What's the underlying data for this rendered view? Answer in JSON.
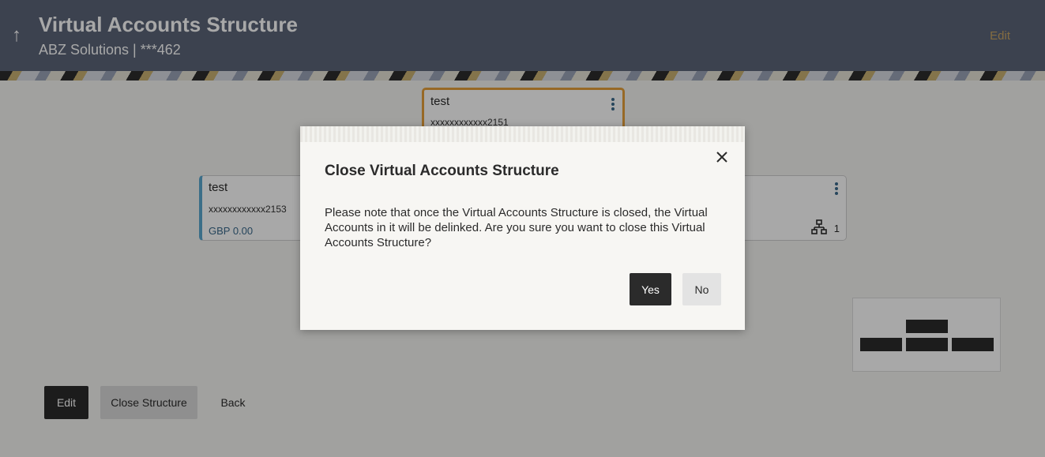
{
  "header": {
    "title": "Virtual Accounts Structure",
    "subtitle": "ABZ Solutions | ***462",
    "edit_label": "Edit",
    "back_icon": "arrow-up-icon"
  },
  "tree": {
    "top_node": {
      "name": "test",
      "account": "xxxxxxxxxxxx2151"
    },
    "left_node": {
      "name": "test",
      "account": "xxxxxxxxxxxx2153",
      "balance": "GBP 0.00"
    },
    "right_node": {
      "hierarchy_count": "1"
    }
  },
  "actions": {
    "edit_label": "Edit",
    "close_structure_label": "Close Structure",
    "back_label": "Back"
  },
  "modal": {
    "title": "Close Virtual Accounts Structure",
    "message": "Please note that once the Virtual Accounts Structure is closed, the Virtual Accounts in it will be delinked. Are you sure you want to close this Virtual Accounts Structure?",
    "yes_label": "Yes",
    "no_label": "No"
  },
  "colors": {
    "header_bg": "#5b6478",
    "accent_gold": "#c9a463",
    "primary_button": "#2b2b2b",
    "node_highlight": "#e6a03a",
    "node_left_border": "#5aa7cf"
  }
}
